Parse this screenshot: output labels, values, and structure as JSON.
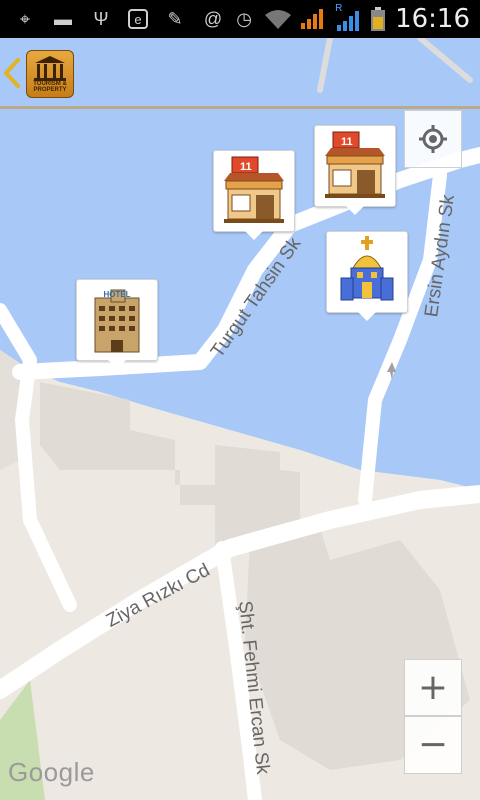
{
  "status_bar": {
    "time": "16:16",
    "icons": [
      "gps-icon",
      "message-icon",
      "usb-icon",
      "e-icon",
      "broom-icon",
      "at-icon"
    ],
    "right_icons": [
      "alarm-icon",
      "wifi-icon",
      "signal-icon",
      "roaming-signal-icon",
      "battery-icon"
    ],
    "roaming_label": "R"
  },
  "app_bar": {
    "back_icon": "chevron-left-icon",
    "logo_caption": "TOURISM & PROPERTY"
  },
  "map": {
    "water_color": "#a8c8f8",
    "land_color": "#ede9e2",
    "road_color": "#ffffff",
    "park_color": "#c8deb0",
    "streets": [
      "Turgut Tahsin Sk",
      "Ersin Aydın Sk",
      "Ziya Rızkı Cd",
      "Şht. Fehmi Ercan Sk"
    ],
    "markers": [
      {
        "name": "hotel-marker",
        "icon": "hotel-icon",
        "sign": "HOTEL"
      },
      {
        "name": "shop-marker-1",
        "icon": "shop-icon",
        "sign": "11"
      },
      {
        "name": "shop-marker-2",
        "icon": "shop-icon",
        "sign": "11"
      },
      {
        "name": "church-marker",
        "icon": "church-icon",
        "sign": ""
      }
    ],
    "attribution": "Google"
  },
  "controls": {
    "my_location_icon": "my-location-icon",
    "zoom_in": "+",
    "zoom_out": "−"
  }
}
